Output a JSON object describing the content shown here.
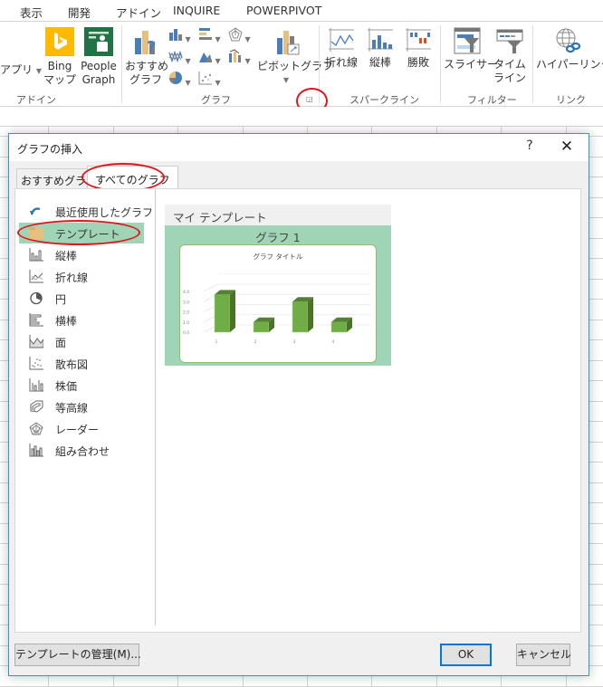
{
  "menu_tabs": [
    "表示",
    "開発",
    "アドイン",
    "INQUIRE",
    "POWERPIVOT"
  ],
  "ribbon": {
    "addins_group": {
      "label": "アドイン",
      "apps_label": "アプリ",
      "bing_label_1": "Bing",
      "bing_label_2": "マップ",
      "people_label_1": "People",
      "people_label_2": "Graph"
    },
    "chart_group": {
      "label": "グラフ",
      "recommended_label_1": "おすすめ",
      "recommended_label_2": "グラフ",
      "pivot_label": "ピボットグラフ",
      "small_icons": [
        "column-chart-icon",
        "bar-chart-icon",
        "radar-chart-icon",
        "line-chart-icon",
        "area-chart-icon",
        "stock-chart-icon",
        "pie-chart-icon",
        "scatter-chart-icon"
      ]
    },
    "sparkline_group": {
      "label": "スパークライン",
      "line_label": "折れ線",
      "column_label": "縦棒",
      "winloss_label": "勝敗"
    },
    "filter_group": {
      "label": "フィルター",
      "slicer_label": "スライサー",
      "timeline_label_1": "タイム",
      "timeline_label_2": "ライン"
    },
    "link_group": {
      "label": "リンク",
      "hyperlink_label": "ハイパーリンク"
    }
  },
  "dialog": {
    "title": "グラフの挿入",
    "help": "?",
    "close": "✕",
    "tabs": [
      "おすすめグラフ",
      "すべてのグラフ"
    ],
    "active_tab": "すべてのグラフ",
    "chart_types": [
      {
        "label": "最近使用したグラフ",
        "icon": "recent-icon"
      },
      {
        "label": "テンプレート",
        "icon": "folder-icon"
      },
      {
        "label": "縦棒",
        "icon": "column-chart-icon"
      },
      {
        "label": "折れ線",
        "icon": "line-chart-icon"
      },
      {
        "label": "円",
        "icon": "pie-chart-icon"
      },
      {
        "label": "横棒",
        "icon": "bar-chart-icon"
      },
      {
        "label": "面",
        "icon": "area-chart-icon"
      },
      {
        "label": "散布図",
        "icon": "scatter-chart-icon"
      },
      {
        "label": "株価",
        "icon": "stock-chart-icon"
      },
      {
        "label": "等高線",
        "icon": "surface-chart-icon"
      },
      {
        "label": "レーダー",
        "icon": "radar-chart-icon"
      },
      {
        "label": "組み合わせ",
        "icon": "combo-chart-icon"
      }
    ],
    "selected_type": "テンプレート",
    "section_header": "マイ テンプレート",
    "template_name": "グラフ 1",
    "buttons": {
      "manage": "テンプレートの管理(M)...",
      "ok": "OK",
      "cancel": "キャンセル"
    },
    "colors": {
      "accent": "#2b9bbf",
      "selection": "#9fd4b6",
      "bar": "#70ad47",
      "annotation": "#e0161c"
    }
  },
  "chart_data": {
    "type": "bar",
    "title": "グラフ タイトル",
    "categories": [
      "1",
      "2",
      "3",
      "4"
    ],
    "values": [
      3.7,
      1.0,
      3.0,
      1.0
    ],
    "y_ticks": [
      "0.0",
      "1.0",
      "2.0",
      "3.0",
      "4.0"
    ],
    "ylim": [
      0,
      4
    ],
    "grid": true,
    "style": "3d-column",
    "xlabel": "",
    "ylabel": ""
  }
}
